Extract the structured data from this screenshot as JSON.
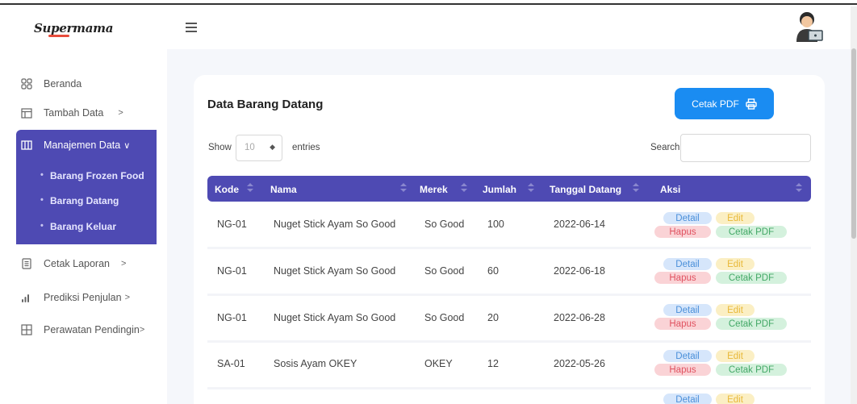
{
  "app": {
    "logo_text": "Supermama"
  },
  "sidebar": {
    "items": [
      {
        "label": "Beranda",
        "icon": "grid-icon"
      },
      {
        "label": "Tambah Data",
        "icon": "table-icon",
        "chevron": ">"
      },
      {
        "label": "Manajemen Data",
        "icon": "columns-icon",
        "chevron": "∨"
      },
      {
        "label": "Cetak Laporan",
        "icon": "document-icon",
        "chevron": ">"
      },
      {
        "label": "Prediksi Penjulan",
        "icon": "bar-chart-icon",
        "chevron": ">"
      },
      {
        "label": "Perawatan Pendingin",
        "icon": "plus-square-icon",
        "chevron": ">"
      }
    ],
    "sub_items": [
      "Barang Frozen Food",
      "Barang Datang",
      "Barang Keluar"
    ]
  },
  "card": {
    "title": "Data Barang Datang",
    "print_button": "Cetak PDF",
    "show_label": "Show",
    "entries_value": "10",
    "entries_label": "entries",
    "search_label": "Search:"
  },
  "table": {
    "columns": [
      "Kode",
      "Nama",
      "Merek",
      "Jumlah",
      "Tanggal Datang",
      "Aksi"
    ],
    "rows": [
      {
        "kode": "NG-01",
        "nama": "Nuget Stick Ayam So Good",
        "merek": "So Good",
        "jumlah": "100",
        "tanggal": "2022-06-14"
      },
      {
        "kode": "NG-01",
        "nama": "Nuget Stick Ayam So Good",
        "merek": "So Good",
        "jumlah": "60",
        "tanggal": "2022-06-18"
      },
      {
        "kode": "NG-01",
        "nama": "Nuget Stick Ayam So Good",
        "merek": "So Good",
        "jumlah": "20",
        "tanggal": "2022-06-28"
      },
      {
        "kode": "SA-01",
        "nama": "Sosis Ayam OKEY",
        "merek": "OKEY",
        "jumlah": "12",
        "tanggal": "2022-05-26"
      }
    ],
    "actions": {
      "detail": "Detail",
      "edit": "Edit",
      "hapus": "Hapus",
      "cetak": "Cetak PDF"
    }
  },
  "colors": {
    "accent": "#4e4ab3",
    "primary_button": "#1a8cf2",
    "background": "#f5f7fb"
  }
}
